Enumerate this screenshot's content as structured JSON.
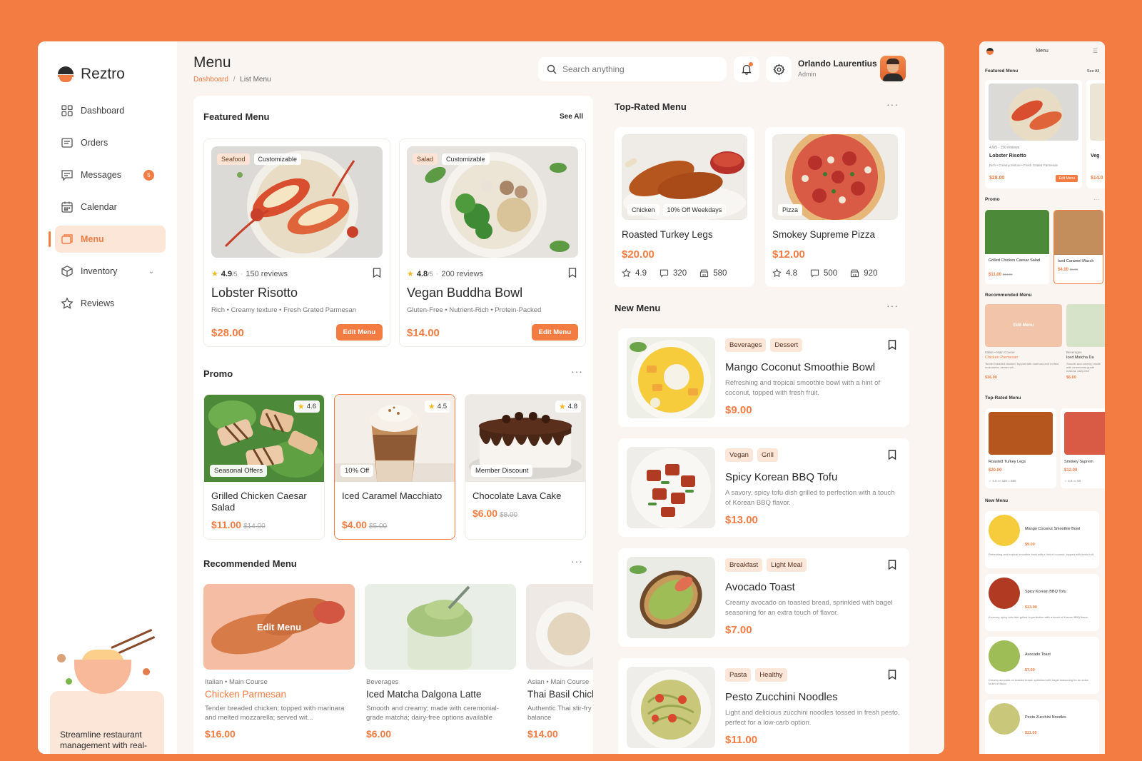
{
  "app": {
    "name": "Reztro"
  },
  "sidebar": {
    "items": [
      {
        "label": "Dashboard",
        "icon": "dashboard-grid-icon"
      },
      {
        "label": "Orders",
        "icon": "orders-icon"
      },
      {
        "label": "Messages",
        "icon": "messages-icon",
        "badge": "5"
      },
      {
        "label": "Calendar",
        "icon": "calendar-icon"
      },
      {
        "label": "Menu",
        "icon": "menu-icon",
        "active": true
      },
      {
        "label": "Inventory",
        "icon": "inventory-box-icon"
      },
      {
        "label": "Reviews",
        "icon": "star-icon"
      }
    ],
    "promo_text": "Streamline restaurant management with real-"
  },
  "header": {
    "title": "Menu",
    "breadcrumb": {
      "link": "Dashboard",
      "separator": "/",
      "current": "List Menu"
    },
    "search_placeholder": "Search anything",
    "user": {
      "name": "Orlando Laurentius",
      "role": "Admin"
    }
  },
  "featured": {
    "title": "Featured Menu",
    "see_all": "See All",
    "items": [
      {
        "tags": [
          "Seafood",
          "Customizable"
        ],
        "rating": "4.9",
        "rating_max": "/5",
        "reviews": "150 reviews",
        "name": "Lobster Risotto",
        "desc": "Rich • Creamy texture • Fresh Grated Parmesan",
        "price": "$28.00",
        "button": "Edit Menu"
      },
      {
        "tags": [
          "Salad",
          "Customizable"
        ],
        "rating": "4.8",
        "rating_max": "/5",
        "reviews": "200 reviews",
        "name": "Vegan Buddha Bowl",
        "desc": "Gluten-Free • Nutrient-Rich • Protein-Packed",
        "price": "$14.00",
        "button": "Edit Menu"
      }
    ]
  },
  "promo": {
    "title": "Promo",
    "items": [
      {
        "rating": "4.6",
        "badge": "Seasonal Offers",
        "name": "Grilled Chicken Caesar Salad",
        "price": "$11.00",
        "old_price": "$14.00"
      },
      {
        "rating": "4.5",
        "badge": "10% Off",
        "name": "Iced Caramel Macchiato",
        "price": "$4.00",
        "old_price": "$5.00"
      },
      {
        "rating": "4.8",
        "badge": "Member Discount",
        "name": "Chocolate Lava Cake",
        "price": "$6.00",
        "old_price": "$8.00"
      }
    ]
  },
  "recommended": {
    "title": "Recommended Menu",
    "overlay_label": "Edit Menu",
    "items": [
      {
        "category": "Italian • Main Course",
        "name": "Chicken Parmesan",
        "desc": "Tender breaded chicken; topped with marinara and melted mozzarella; served wit...",
        "price": "$16.00"
      },
      {
        "category": "Beverages",
        "name": "Iced Matcha Dalgona Latte",
        "desc": "Smooth and creamy; made with ceremonial-grade matcha; dairy-free options available",
        "price": "$6.00"
      },
      {
        "category": "Asian • Main Course",
        "name": "Thai Basil Chicken",
        "desc": "Authentic Thai stir-fry with jasmine rice; perfect balance",
        "price": "$14.00"
      }
    ]
  },
  "top_rated": {
    "title": "Top-Rated Menu",
    "items": [
      {
        "tags": [
          "Chicken",
          "10% Off Weekdays"
        ],
        "name": "Roasted Turkey Legs",
        "price": "$20.00",
        "rating": "4.9",
        "reviews": "320",
        "sold": "580"
      },
      {
        "tags": [
          "Pizza"
        ],
        "name": "Smokey Supreme Pizza",
        "price": "$12.00",
        "rating": "4.8",
        "reviews": "500",
        "sold": "920"
      }
    ]
  },
  "new_menu": {
    "title": "New Menu",
    "items": [
      {
        "tags": [
          "Beverages",
          "Dessert"
        ],
        "name": "Mango Coconut Smoothie Bowl",
        "desc": "Refreshing and tropical smoothie bowl with a hint of coconut, topped with fresh fruit.",
        "price": "$9.00"
      },
      {
        "tags": [
          "Vegan",
          "Grill"
        ],
        "name": "Spicy Korean BBQ Tofu",
        "desc": "A savory, spicy tofu dish grilled to perfection with a touch of Korean BBQ flavor.",
        "price": "$13.00"
      },
      {
        "tags": [
          "Breakfast",
          "Light Meal"
        ],
        "name": "Avocado Toast",
        "desc": "Creamy avocado on toasted bread, sprinkled with bagel seasoning for an extra touch of flavor.",
        "price": "$7.00"
      },
      {
        "tags": [
          "Pasta",
          "Healthy"
        ],
        "name": "Pesto Zucchini Noodles",
        "desc": "Light and delicious zucchini noodles tossed in fresh pesto, perfect for a low-carb option.",
        "price": "$11.00"
      }
    ]
  },
  "mobile": {
    "title": "Menu",
    "featured": "Featured Menu",
    "see_all": "See All",
    "card_name": "Lobster Risotto",
    "card_meta": "4.9/5 · 150 reviews",
    "card_desc": "Rich • Creamy texture • Fresh Grated Parmesan",
    "card_price": "$28.00",
    "card_btn": "Edit Menu",
    "peek_name": "Veg",
    "peek_price": "$14.0",
    "promo": "Promo",
    "promo_1": "Grilled Chicken Caesar Salad",
    "promo_1_price": "$11.00",
    "promo_1_old": "$14.00",
    "promo_2": "Iced Caramel Macch",
    "promo_2_price": "$4.00",
    "promo_2_old": "$5.00",
    "recommended": "Recommended Menu",
    "rec_edit": "Edit Menu",
    "rec_1_cat": "Italian • Main Course",
    "rec_1": "Chicken Parmesan",
    "rec_1_desc": "Tender breaded chicken; topped with marinara and melted mozzarella; served wit...",
    "rec_1_price": "$16.00",
    "rec_2_cat": "Beverages",
    "rec_2": "Iced Matcha Da",
    "rec_2_desc": "Smooth and creamy; made with ceremonial-grade matcha; dairy-free",
    "rec_2_price": "$6.00",
    "top": "Top-Rated Menu",
    "top_1": "Roasted Turkey Legs",
    "top_1_price": "$20.00",
    "top_1_stats": "☆ 4.9   ▭ 320   ⌂ 580",
    "top_2": "Smokey Suprem",
    "top_2_price": "$12.00",
    "top_2_stats": "☆ 4.8   ▭ 50",
    "new": "New Menu",
    "new_1": "Mango Coconut Smoothie Bowl",
    "new_1_price": "$9.00",
    "new_1_desc": "Refreshing and tropical smoothie bowl with a hint of coconut, topped with fresh fruit.",
    "new_2": "Spicy Korean BBQ Tofu",
    "new_2_price": "$13.00",
    "new_2_desc": "A savory, spicy tofu dish grilled to perfection with a touch of Korean BBQ flavor.",
    "new_3": "Avocado Toast",
    "new_3_price": "$7.00",
    "new_3_desc": "Creamy avocado on toasted bread, sprinkled with bagel seasoning for an extra touch of flavor.",
    "new_4": "Pesto Zucchini Noodles",
    "new_4_price": "$11.00"
  },
  "colors": {
    "accent": "#F27C42",
    "background": "#F27C42",
    "panel": "#FAF5F1"
  }
}
